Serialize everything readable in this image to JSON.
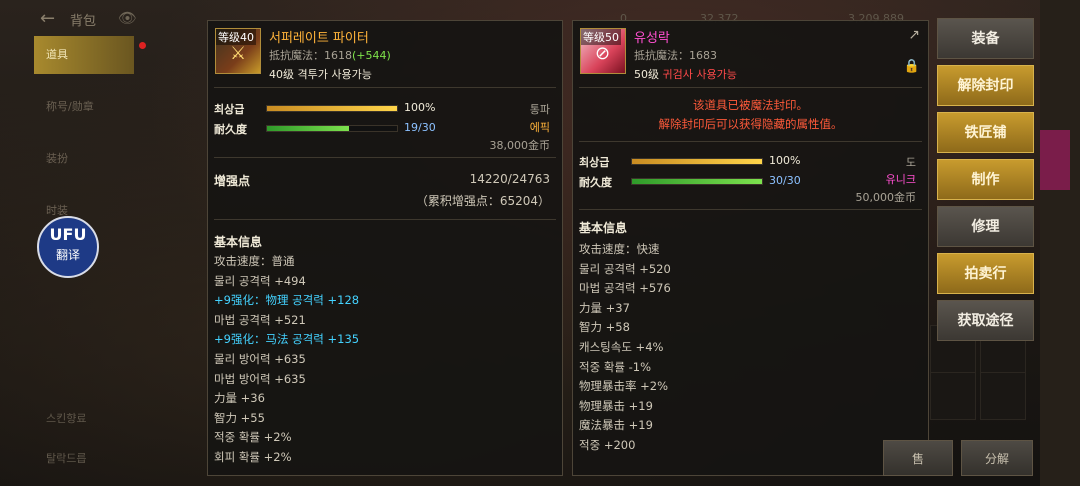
{
  "header": {
    "back_icon": "←",
    "title": "背包",
    "eye_icon": "👁"
  },
  "left_nav": {
    "items": [
      "道具",
      "称号/勋章",
      "装扮",
      "时装"
    ],
    "bottom": [
      "스킨향료",
      "탈락드릅"
    ]
  },
  "translate_button": {
    "icon": "UFU",
    "label": "翻译"
  },
  "panel_left": {
    "level": "等级40",
    "name": "서퍼레이트 파이터",
    "resist_label": "抵抗魔法：",
    "resist_value": "1618",
    "resist_bonus": "(+544)",
    "req_level": "40级",
    "req_class": "격투가 사용가능",
    "grade_label": "최상급",
    "grade_pct": "100%",
    "grade_value": 100,
    "grade_type": "통파",
    "dur_label": "耐久度",
    "dur_text": "19/30",
    "dur_value": 63,
    "rarity": "에픽",
    "price": "38,000金币",
    "enhance_label": "增强点",
    "enhance_value": "14220/24763",
    "enhance_total": "（累积增强点：65204）",
    "section": "基本信息",
    "stats": [
      {
        "text": "攻击速度：普通",
        "cyan": false
      },
      {
        "text": "물리 공격력 +494",
        "cyan": false
      },
      {
        "text": "+9强化：物理 공격력 +128",
        "cyan": true
      },
      {
        "text": "마법 공격력 +521",
        "cyan": false
      },
      {
        "text": "+9强化：马法 공격력 +135",
        "cyan": true
      },
      {
        "text": "물리 방어력 +635",
        "cyan": false
      },
      {
        "text": "마법 방어력 +635",
        "cyan": false
      },
      {
        "text": "力量 +36",
        "cyan": false
      },
      {
        "text": "智力 +55",
        "cyan": false
      },
      {
        "text": "적중 확률 +2%",
        "cyan": false
      },
      {
        "text": "회피 확률 +2%",
        "cyan": false
      }
    ]
  },
  "panel_right": {
    "level": "等级50",
    "name": "유성락",
    "resist_label": "抵抗魔法：",
    "resist_value": "1683",
    "req_level": "50级",
    "req_class": "귀검사 사용가능",
    "lock_icon": "🔒",
    "share_icon": "↗",
    "sealed_line1": "该道具已被魔法封印。",
    "sealed_line2": "解除封印后可以获得隐藏的属性值。",
    "grade_label": "최상급",
    "grade_pct": "100%",
    "grade_value": 100,
    "grade_type": "도",
    "dur_label": "耐久度",
    "dur_text": "30/30",
    "dur_value": 100,
    "rarity": "유니크",
    "price": "50,000金币",
    "section": "基本信息",
    "stats": [
      "攻击速度：快速",
      "물리 공격력 +520",
      "마법 공격력 +576",
      "力量 +37",
      "智力 +58",
      "캐스팅속도 +4%",
      "적중 확률 -1%",
      "物理暴击率 +2%",
      "物理暴击 +19",
      "魔法暴击 +19",
      "적중 +200"
    ]
  },
  "actions": [
    {
      "label": "装备",
      "style": "gray"
    },
    {
      "label": "解除封印",
      "style": "gold"
    },
    {
      "label": "铁匠铺",
      "style": "gold"
    },
    {
      "label": "制作",
      "style": "gold"
    },
    {
      "label": "修理",
      "style": "gray"
    },
    {
      "label": "拍卖行",
      "style": "gold"
    },
    {
      "label": "获取途径",
      "style": "gray"
    }
  ],
  "bottom_buttons": [
    "售",
    "分解"
  ],
  "colors": {
    "gold_title": "#ffb33a",
    "cyan": "#44d2ff",
    "red": "#ff5a3a",
    "green": "#7ee24a"
  }
}
